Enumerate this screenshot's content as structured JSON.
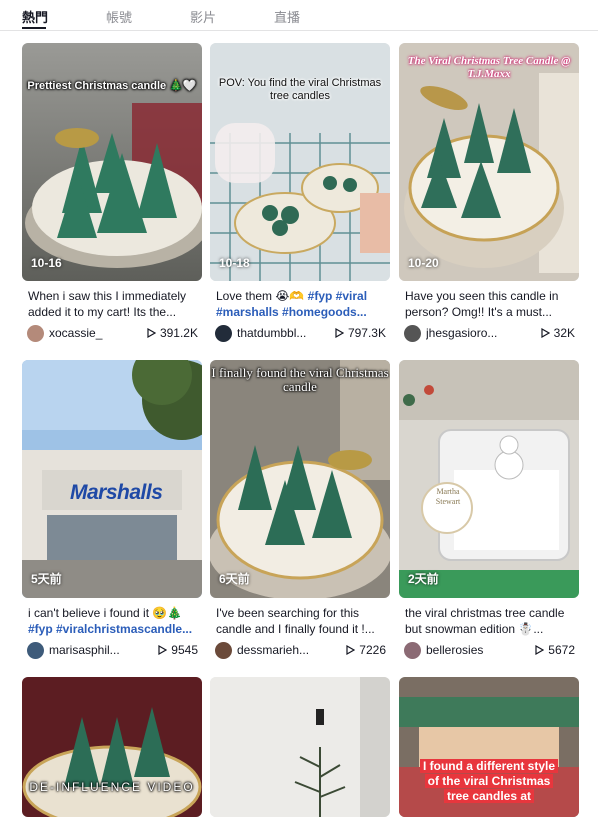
{
  "tabs": [
    {
      "label": "熱門",
      "active": true
    },
    {
      "label": "帳號",
      "active": false
    },
    {
      "label": "影片",
      "active": false
    },
    {
      "label": "直播",
      "active": false
    }
  ],
  "videos": [
    {
      "overlay": "Prettiest Christmas candle 🎄🤍",
      "date": "10-16",
      "desc_plain": "When i saw this I immediately added it to my cart! Its the...",
      "user": "xocassie_",
      "views": "391.2K",
      "avatar_color": "#b48a7a"
    },
    {
      "overlay": "POV: You find the viral Christmas tree candles",
      "date": "10-18",
      "desc_plain": "Love them 😭🫶 ",
      "tags": "#fyp #viral #marshalls #homegoods...",
      "user": "thatdumbbl...",
      "views": "797.3K",
      "avatar_color": "#222c3a"
    },
    {
      "overlay": "The Viral Christmas Tree Candle @ T.J.Maxx",
      "date": "10-20",
      "desc_plain": "Have you seen this candle in person? Omg!! It's a must...",
      "user": "jhesgasioro...",
      "views": "32K",
      "avatar_color": "#555555"
    },
    {
      "overlay": "",
      "date": "5天前",
      "desc_plain": "i can't believe i found it 🥹🎄 ",
      "tags": "#fyp #viralchristmascandle...",
      "user": "marisasphil...",
      "views": "9545",
      "avatar_color": "#3e5b7a"
    },
    {
      "overlay": "I finally found the viral Christmas candle",
      "date": "6天前",
      "desc_plain": "I've been searching for this candle and I finally found it !...",
      "user": "dessmarieh...",
      "views": "7226",
      "avatar_color": "#6b4a3a"
    },
    {
      "overlay": "",
      "date": "2天前",
      "desc_plain": "the viral christmas tree candle but snowman edition ☃️...",
      "user": "bellerosies",
      "views": "5672",
      "avatar_color": "#8b6a74"
    },
    {
      "overlay": "DE-INFLUENCE VIDEO",
      "date": "",
      "desc_plain": "",
      "user": "",
      "views": "",
      "avatar_color": "#333"
    },
    {
      "overlay": "",
      "date": "",
      "desc_plain": "",
      "user": "",
      "views": "",
      "avatar_color": "#333"
    },
    {
      "overlay": "I found a different style of the viral Christmas tree candles at",
      "date": "",
      "desc_plain": "",
      "user": "",
      "views": "",
      "avatar_color": "#333"
    }
  ],
  "storefront_sign": "Marshalls",
  "jar_label": "Martha Stewart",
  "colors": {
    "accent_tag": "#2b5db9",
    "text": "#161823",
    "muted": "#8a8b91"
  }
}
